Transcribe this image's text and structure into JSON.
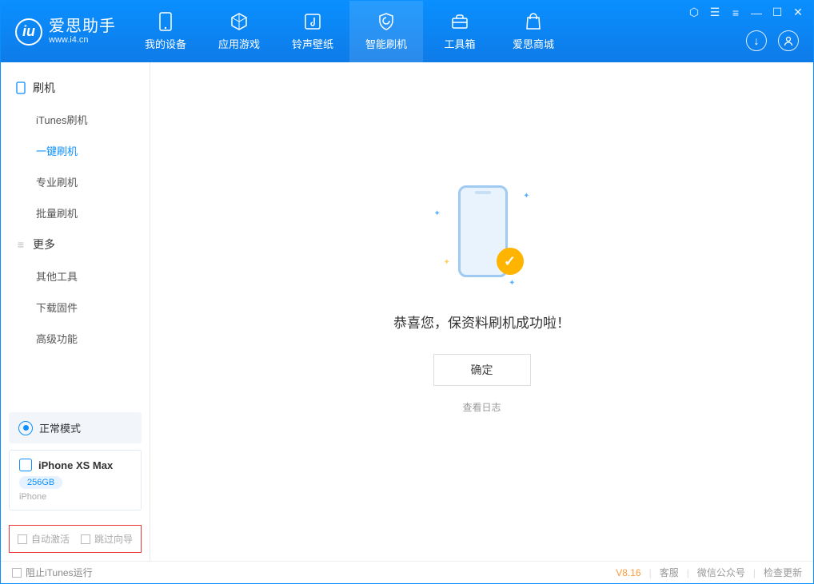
{
  "app": {
    "title": "爱思助手",
    "subtitle": "www.i4.cn"
  },
  "nav": {
    "items": [
      {
        "label": "我的设备"
      },
      {
        "label": "应用游戏"
      },
      {
        "label": "铃声壁纸"
      },
      {
        "label": "智能刷机"
      },
      {
        "label": "工具箱"
      },
      {
        "label": "爱思商城"
      }
    ]
  },
  "sidebar": {
    "group1": "刷机",
    "items1": [
      {
        "label": "iTunes刷机"
      },
      {
        "label": "一键刷机"
      },
      {
        "label": "专业刷机"
      },
      {
        "label": "批量刷机"
      }
    ],
    "group2": "更多",
    "items2": [
      {
        "label": "其他工具"
      },
      {
        "label": "下载固件"
      },
      {
        "label": "高级功能"
      }
    ]
  },
  "mode": {
    "label": "正常模式"
  },
  "device": {
    "name": "iPhone XS Max",
    "capacity": "256GB",
    "type": "iPhone"
  },
  "opts": {
    "auto_activate": "自动激活",
    "skip_guide": "跳过向导"
  },
  "main": {
    "success_text": "恭喜您，保资料刷机成功啦！",
    "ok": "确定",
    "view_log": "查看日志"
  },
  "footer": {
    "block_itunes": "阻止iTunes运行",
    "version": "V8.16",
    "service": "客服",
    "wechat": "微信公众号",
    "update": "检查更新"
  }
}
